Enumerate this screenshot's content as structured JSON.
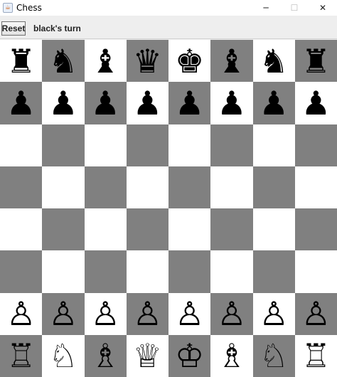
{
  "window": {
    "title": "Chess",
    "app_icon": "java-cup-icon",
    "controls": {
      "minimize": "─",
      "maximize": "☐",
      "close": "✕"
    }
  },
  "toolbar": {
    "reset_label": "Reset",
    "status": "black's turn"
  },
  "board": {
    "light_color": "#ffffff",
    "dark_color": "#808080",
    "rows": [
      [
        {
          "glyph": "♜",
          "name": "black-rook"
        },
        {
          "glyph": "♞",
          "name": "black-knight"
        },
        {
          "glyph": "♝",
          "name": "black-bishop"
        },
        {
          "glyph": "♛",
          "name": "black-queen"
        },
        {
          "glyph": "♚",
          "name": "black-king"
        },
        {
          "glyph": "♝",
          "name": "black-bishop"
        },
        {
          "glyph": "♞",
          "name": "black-knight"
        },
        {
          "glyph": "♜",
          "name": "black-rook"
        }
      ],
      [
        {
          "glyph": "♟",
          "name": "black-pawn"
        },
        {
          "glyph": "♟",
          "name": "black-pawn"
        },
        {
          "glyph": "♟",
          "name": "black-pawn"
        },
        {
          "glyph": "♟",
          "name": "black-pawn"
        },
        {
          "glyph": "♟",
          "name": "black-pawn"
        },
        {
          "glyph": "♟",
          "name": "black-pawn"
        },
        {
          "glyph": "♟",
          "name": "black-pawn"
        },
        {
          "glyph": "♟",
          "name": "black-pawn"
        }
      ],
      [
        null,
        null,
        null,
        null,
        null,
        null,
        null,
        null
      ],
      [
        null,
        null,
        null,
        null,
        null,
        null,
        null,
        null
      ],
      [
        null,
        null,
        null,
        null,
        null,
        null,
        null,
        null
      ],
      [
        null,
        null,
        null,
        null,
        null,
        null,
        null,
        null
      ],
      [
        {
          "glyph": "♙",
          "name": "white-pawn"
        },
        {
          "glyph": "♙",
          "name": "white-pawn"
        },
        {
          "glyph": "♙",
          "name": "white-pawn"
        },
        {
          "glyph": "♙",
          "name": "white-pawn"
        },
        {
          "glyph": "♙",
          "name": "white-pawn"
        },
        {
          "glyph": "♙",
          "name": "white-pawn"
        },
        {
          "glyph": "♙",
          "name": "white-pawn"
        },
        {
          "glyph": "♙",
          "name": "white-pawn"
        }
      ],
      [
        {
          "glyph": "♖",
          "name": "white-rook"
        },
        {
          "glyph": "♘",
          "name": "white-knight"
        },
        {
          "glyph": "♗",
          "name": "white-bishop"
        },
        {
          "glyph": "♕",
          "name": "white-queen"
        },
        {
          "glyph": "♔",
          "name": "white-king"
        },
        {
          "glyph": "♗",
          "name": "white-bishop"
        },
        {
          "glyph": "♘",
          "name": "white-knight"
        },
        {
          "glyph": "♖",
          "name": "white-rook"
        }
      ]
    ]
  }
}
